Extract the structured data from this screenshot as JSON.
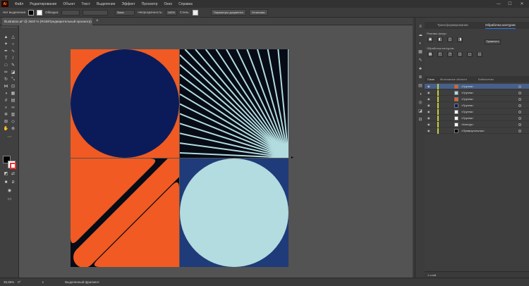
{
  "app": {
    "logo_text": "Ai"
  },
  "menu": [
    "Файл",
    "Редактирование",
    "Объект",
    "Текст",
    "Выделение",
    "Эффект",
    "Просмотр",
    "Окно",
    "Справка"
  ],
  "window_controls": [
    "—",
    "☐",
    "✕"
  ],
  "control_bar": {
    "selection_label": "Нет выделения",
    "stroke_label": "Обводка:",
    "style_value": "Basic",
    "opacity_label": "Непрозрачность:",
    "opacity_value": "100%",
    "style_label": "Стиль:",
    "doc_settings": "Параметры документа",
    "prefs": "Установки"
  },
  "document_tab": {
    "title": "Illustration.ai* @ 3620 % (RGB/Предварительный просмотр)",
    "close": "×"
  },
  "status_bar": {
    "zoom": "35,85%",
    "rotation": "0°",
    "page": "1",
    "mode": "Выделенный фрагмент"
  },
  "panels": {
    "top_tabs": [
      "Трансформирование",
      "Обработка контуров"
    ],
    "top_active": 1,
    "shape_modes_label": "Режимы фигур:",
    "pathfinder_label": "Обработка контуров:",
    "apply_label": "Применить",
    "layers_tabs": [
      "Слои",
      "Монтажные области",
      "Библиотеки"
    ],
    "layers_active": 0,
    "layers": [
      {
        "name": "<Группа>",
        "thumb": "#f15a22",
        "selected": true
      },
      {
        "name": "<Группа>",
        "thumb": "#b2dcdf",
        "selected": false
      },
      {
        "name": "<Группа>",
        "thumb": "#f15a22",
        "selected": false
      },
      {
        "name": "<Группа>",
        "thumb": "#0b1b5a",
        "selected": false
      },
      {
        "name": "<Группа>",
        "thumb": "#ffffff",
        "selected": false
      },
      {
        "name": "<Группа>",
        "thumb": "#ffffff",
        "selected": false
      },
      {
        "name": "<Контур>",
        "thumb": "#ffffff",
        "selected": false
      },
      {
        "name": "<Прямоугольник>",
        "thumb": "#000000",
        "selected": false
      }
    ],
    "layers_footer": "1 слой"
  },
  "colors": {
    "orange": "#f15a22",
    "navy": "#0b1b5a",
    "light_blue": "#b2dcdf",
    "blue": "#1f3b7a",
    "black": "#060b16",
    "selection_blue": "#46608a"
  }
}
